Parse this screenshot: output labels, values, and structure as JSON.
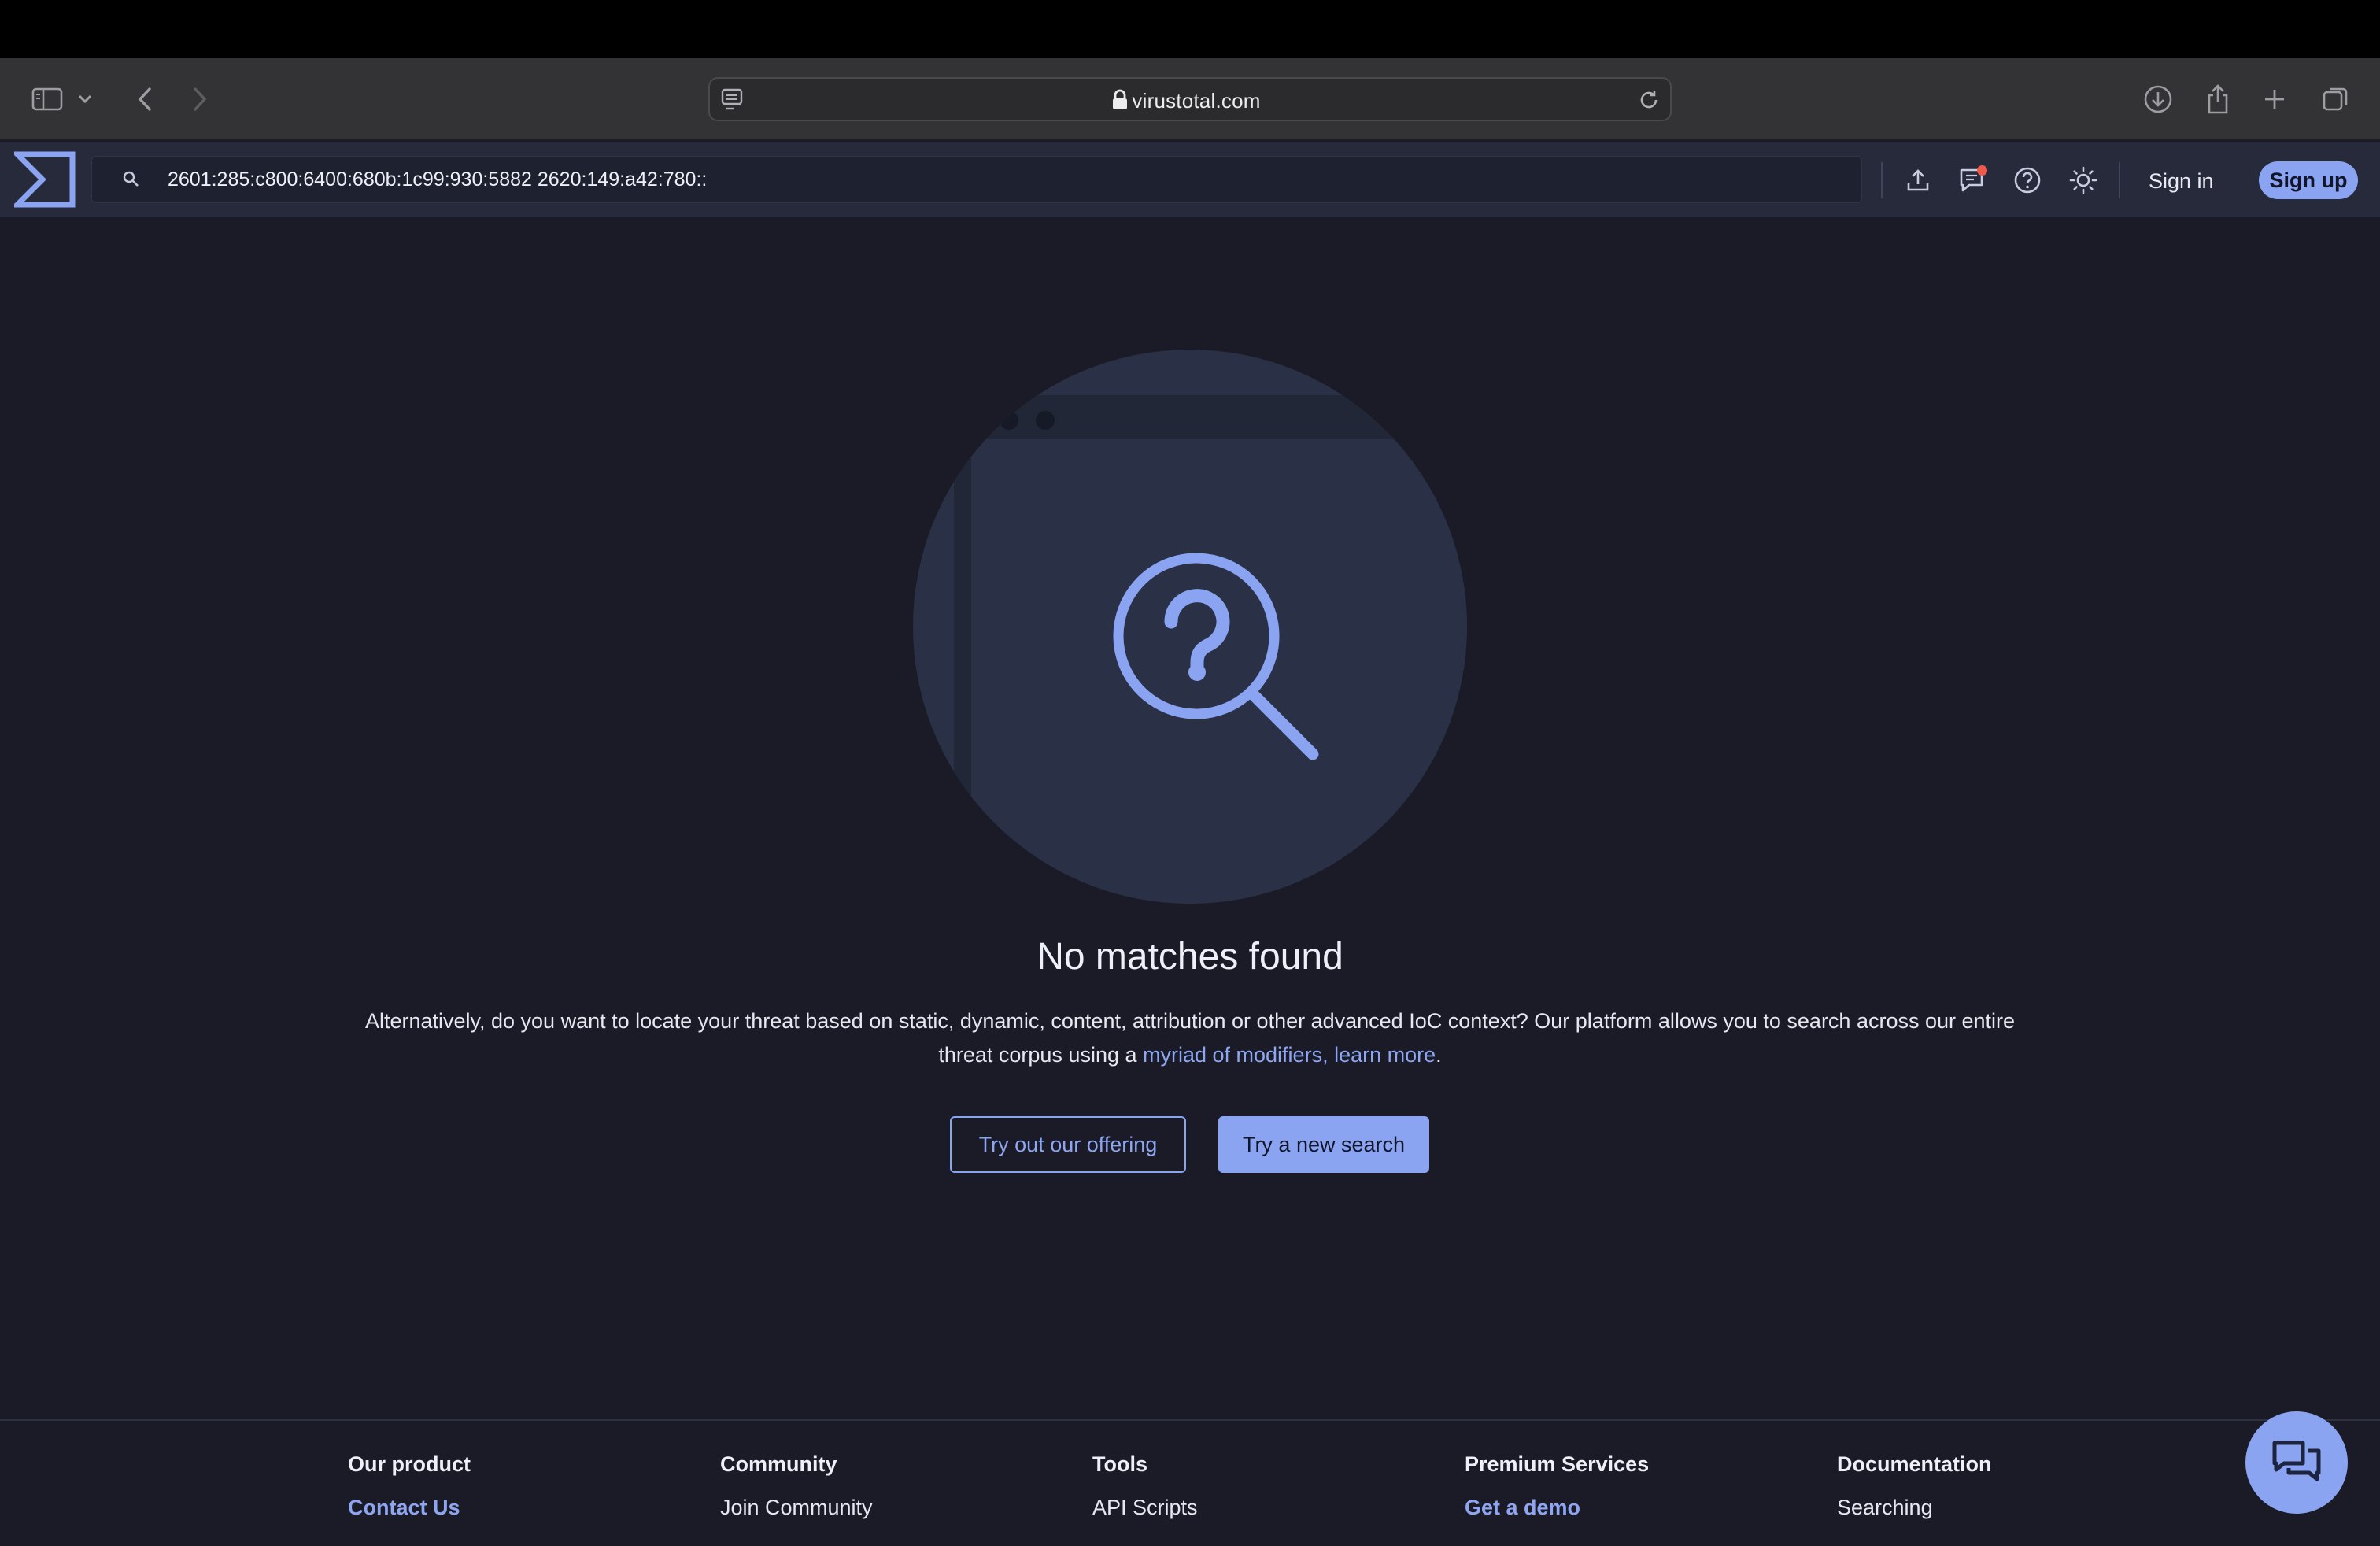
{
  "browser": {
    "domain": "virustotal.com"
  },
  "header": {
    "search_value": "2601:285:c800:6400:680b:1c99:930:5882 2620:149:a42:780::",
    "signin_label": "Sign in",
    "signup_label": "Sign up",
    "icons": [
      "upload-icon",
      "chat-notification-icon",
      "help-icon",
      "theme-toggle-icon"
    ]
  },
  "main": {
    "title": "No matches found",
    "desc_line1": "Alternatively, do you want to locate your threat based on static, dynamic, content, attribution or other advanced IoC context? Our platform allows you to search across our entire",
    "desc_line2_prefix": "threat corpus using a ",
    "desc_link": "myriad of modifiers, learn more",
    "desc_suffix": ".",
    "btn_offering": "Try out our offering",
    "btn_new_search": "Try a new search"
  },
  "footer": {
    "columns": [
      {
        "heading": "Our product",
        "link": "Contact Us",
        "accent": true
      },
      {
        "heading": "Community",
        "link": "Join Community",
        "accent": false
      },
      {
        "heading": "Tools",
        "link": "API Scripts",
        "accent": false
      },
      {
        "heading": "Premium Services",
        "link": "Get a demo",
        "accent": true
      },
      {
        "heading": "Documentation",
        "link": "Searching",
        "accent": false
      }
    ]
  },
  "colors": {
    "accent": "#8aa4f2",
    "background": "#1a1b27",
    "header": "#262a3a",
    "notification": "#ef5b4b"
  }
}
